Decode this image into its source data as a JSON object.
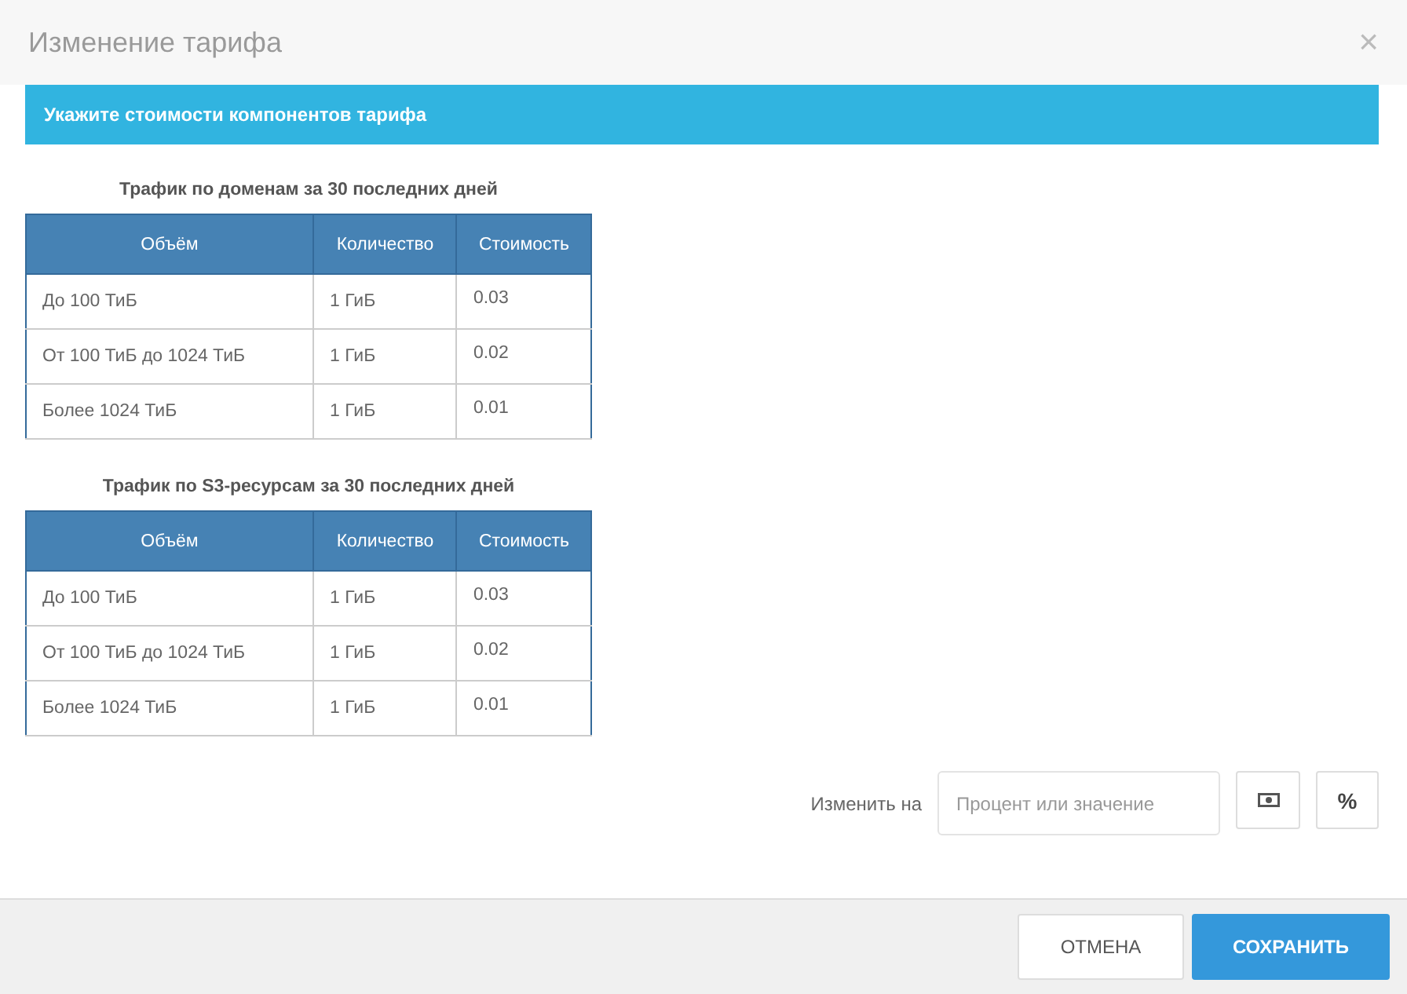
{
  "dialog": {
    "title": "Изменение тарифа",
    "close": "×"
  },
  "banner": "Укажите стоимости компонентов тарифа",
  "tables": [
    {
      "caption": "Трафик по доменам за 30 последних дней",
      "columns": [
        "Объём",
        "Количество",
        "Стоимость"
      ],
      "rows": [
        [
          "До 100 ТиБ",
          "1 ГиБ",
          "0.03"
        ],
        [
          "От 100 ТиБ до 1024 ТиБ",
          "1 ГиБ",
          "0.02"
        ],
        [
          "Более 1024 ТиБ",
          "1 ГиБ",
          "0.01"
        ]
      ]
    },
    {
      "caption": "Трафик по S3-ресурсам за 30 последних дней",
      "columns": [
        "Объём",
        "Количество",
        "Стоимость"
      ],
      "rows": [
        [
          "До 100 ТиБ",
          "1 ГиБ",
          "0.03"
        ],
        [
          "От 100 ТиБ до 1024 ТиБ",
          "1 ГиБ",
          "0.02"
        ],
        [
          "Более 1024 ТиБ",
          "1 ГиБ",
          "0.01"
        ]
      ]
    }
  ],
  "change": {
    "label": "Изменить на",
    "placeholder": "Процент или значение",
    "percent_button": "%"
  },
  "buttons": [
    {
      "label": "ОТМЕНА",
      "kind": "secondary"
    },
    {
      "label": "СОХРАНИТЬ",
      "kind": "primary"
    }
  ]
}
